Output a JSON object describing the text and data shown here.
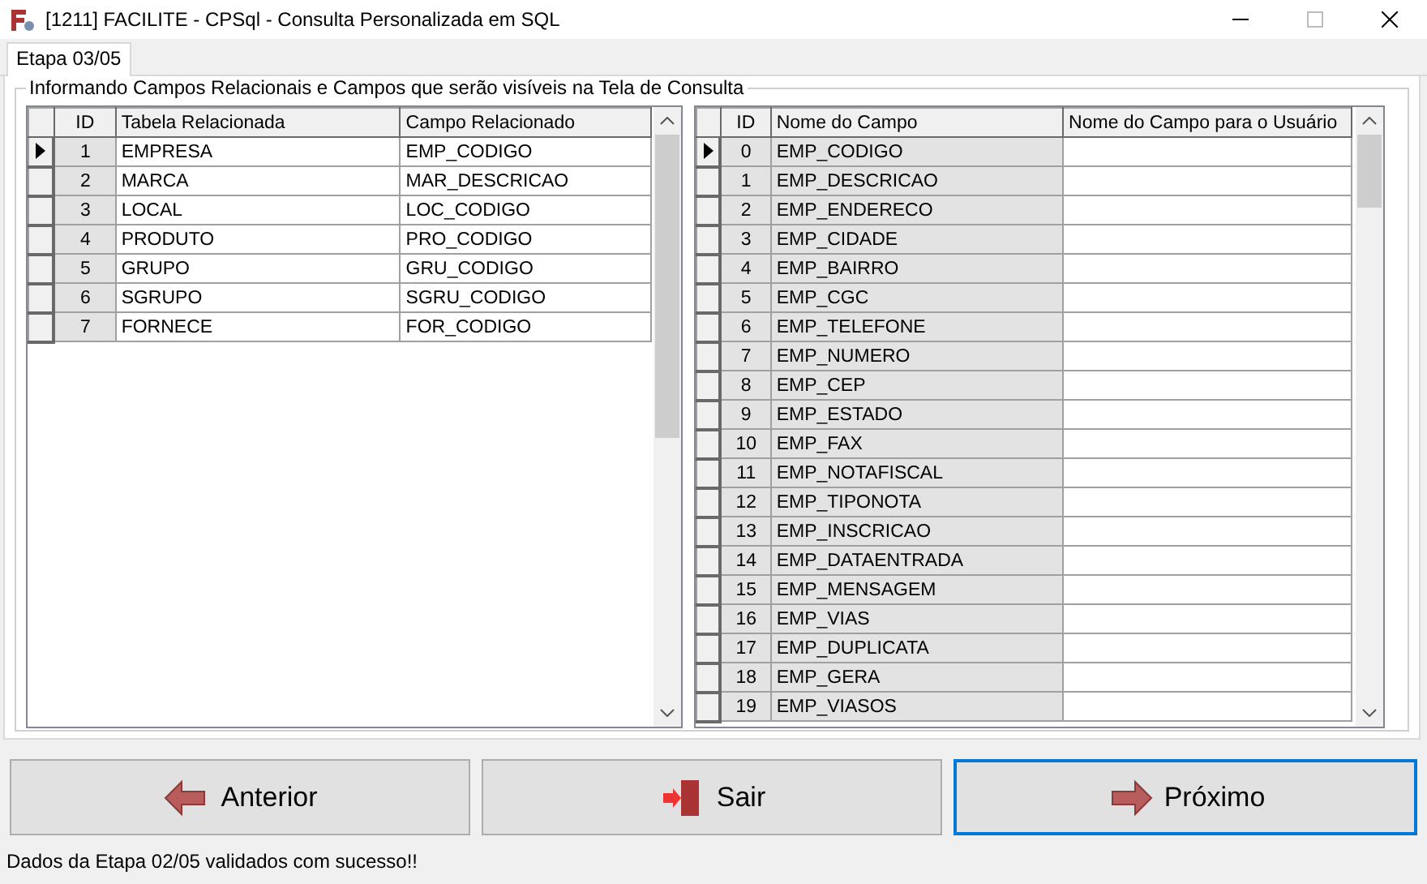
{
  "window": {
    "title": "[1211] FACILITE - CPSql - Consulta Personalizada em SQL"
  },
  "tabs": [
    {
      "label": "Etapa 03/05",
      "selected": true
    }
  ],
  "group": {
    "caption": "Informando Campos Relacionais e Campos que serão visíveis na Tela de Consulta"
  },
  "grids": [
    {
      "columns": [
        {
          "label": "ID",
          "readonly": true
        },
        {
          "label": "Tabela Relacionada",
          "readonly": false
        },
        {
          "label": "Campo Relacionado",
          "readonly": false
        }
      ],
      "rows": [
        {
          "current": true,
          "cells": [
            "1",
            "EMPRESA",
            "EMP_CODIGO"
          ]
        },
        {
          "current": false,
          "cells": [
            "2",
            "MARCA",
            "MAR_DESCRICAO"
          ]
        },
        {
          "current": false,
          "cells": [
            "3",
            "LOCAL",
            "LOC_CODIGO"
          ]
        },
        {
          "current": false,
          "cells": [
            "4",
            "PRODUTO",
            "PRO_CODIGO"
          ]
        },
        {
          "current": false,
          "cells": [
            "5",
            "GRUPO",
            "GRU_CODIGO"
          ]
        },
        {
          "current": false,
          "cells": [
            "6",
            "SGRUPO",
            "SGRU_CODIGO"
          ]
        },
        {
          "current": false,
          "cells": [
            "7",
            "FORNECE",
            "FOR_CODIGO"
          ]
        }
      ]
    },
    {
      "columns": [
        {
          "label": "ID",
          "readonly": true
        },
        {
          "label": "Nome do Campo",
          "readonly": true
        },
        {
          "label": "Nome do Campo para o Usuário",
          "readonly": false
        }
      ],
      "rows": [
        {
          "current": true,
          "cells": [
            "0",
            "EMP_CODIGO"
          ]
        },
        {
          "current": false,
          "cells": [
            "1",
            "EMP_DESCRICAO"
          ]
        },
        {
          "current": false,
          "cells": [
            "2",
            "EMP_ENDERECO"
          ]
        },
        {
          "current": false,
          "cells": [
            "3",
            "EMP_CIDADE"
          ]
        },
        {
          "current": false,
          "cells": [
            "4",
            "EMP_BAIRRO"
          ]
        },
        {
          "current": false,
          "cells": [
            "5",
            "EMP_CGC"
          ]
        },
        {
          "current": false,
          "cells": [
            "6",
            "EMP_TELEFONE"
          ]
        },
        {
          "current": false,
          "cells": [
            "7",
            "EMP_NUMERO"
          ]
        },
        {
          "current": false,
          "cells": [
            "8",
            "EMP_CEP"
          ]
        },
        {
          "current": false,
          "cells": [
            "9",
            "EMP_ESTADO"
          ]
        },
        {
          "current": false,
          "cells": [
            "10",
            "EMP_FAX"
          ]
        },
        {
          "current": false,
          "cells": [
            "11",
            "EMP_NOTAFISCAL"
          ]
        },
        {
          "current": false,
          "cells": [
            "12",
            "EMP_TIPONOTA"
          ]
        },
        {
          "current": false,
          "cells": [
            "13",
            "EMP_INSCRICAO"
          ]
        },
        {
          "current": false,
          "cells": [
            "14",
            "EMP_DATAENTRADA"
          ]
        },
        {
          "current": false,
          "cells": [
            "15",
            "EMP_MENSAGEM"
          ]
        },
        {
          "current": false,
          "cells": [
            "16",
            "EMP_VIAS"
          ]
        },
        {
          "current": false,
          "cells": [
            "17",
            "EMP_DUPLICATA"
          ]
        },
        {
          "current": false,
          "cells": [
            "18",
            "EMP_GERA"
          ]
        },
        {
          "current": false,
          "cells": [
            "19",
            "EMP_VIASOS"
          ]
        }
      ]
    }
  ],
  "buttons": [
    {
      "kind": "back",
      "label": "Anterior",
      "focused": false
    },
    {
      "kind": "exit",
      "label": "Sair",
      "focused": false
    },
    {
      "kind": "next",
      "label": "Próximo",
      "focused": true
    }
  ],
  "status_bar": "Dados da Etapa 02/05 validados com sucesso!!"
}
